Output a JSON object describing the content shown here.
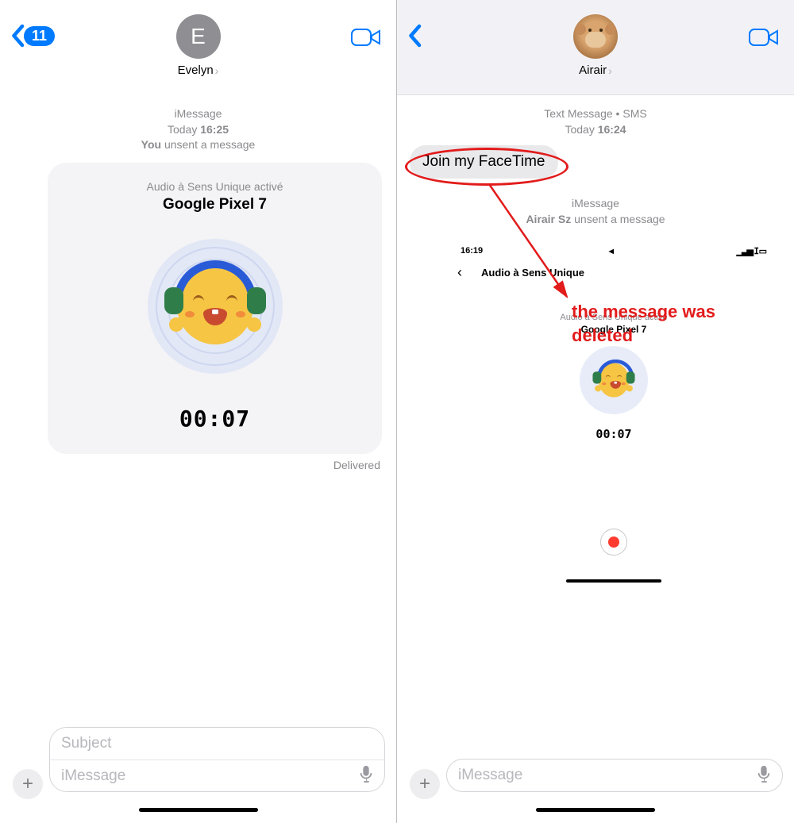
{
  "left": {
    "back_badge": "11",
    "avatar_initial": "E",
    "contact_name": "Evelyn",
    "meta_service": "iMessage",
    "meta_time_prefix": "Today",
    "meta_time": "16:25",
    "unsent_prefix": "You",
    "unsent_suffix": "unsent a message",
    "card": {
      "subtitle": "Audio à Sens Unique activé",
      "title": "Google Pixel 7",
      "timer": "00:07"
    },
    "delivered": "Delivered",
    "input_subject_placeholder": "Subject",
    "input_message_placeholder": "iMessage"
  },
  "right": {
    "contact_name": "Airair",
    "meta_service": "Text Message • SMS",
    "meta_time_prefix": "Today",
    "meta_time": "16:24",
    "bubble_text": "Join my FaceTime",
    "meta_service2": "iMessage",
    "unsent_line_prefix": "Airair Sz",
    "unsent_line_suffix": "unsent a message",
    "nested": {
      "status_time": "16:19",
      "header_title": "Audio à Sens Unique",
      "subtitle": "Audio à Sens Unique activé",
      "title": "Google Pixel 7",
      "timer": "00:07"
    },
    "input_message_placeholder": "iMessage"
  },
  "annotation": {
    "text_line1": "the message was",
    "text_line2": "deleted"
  }
}
